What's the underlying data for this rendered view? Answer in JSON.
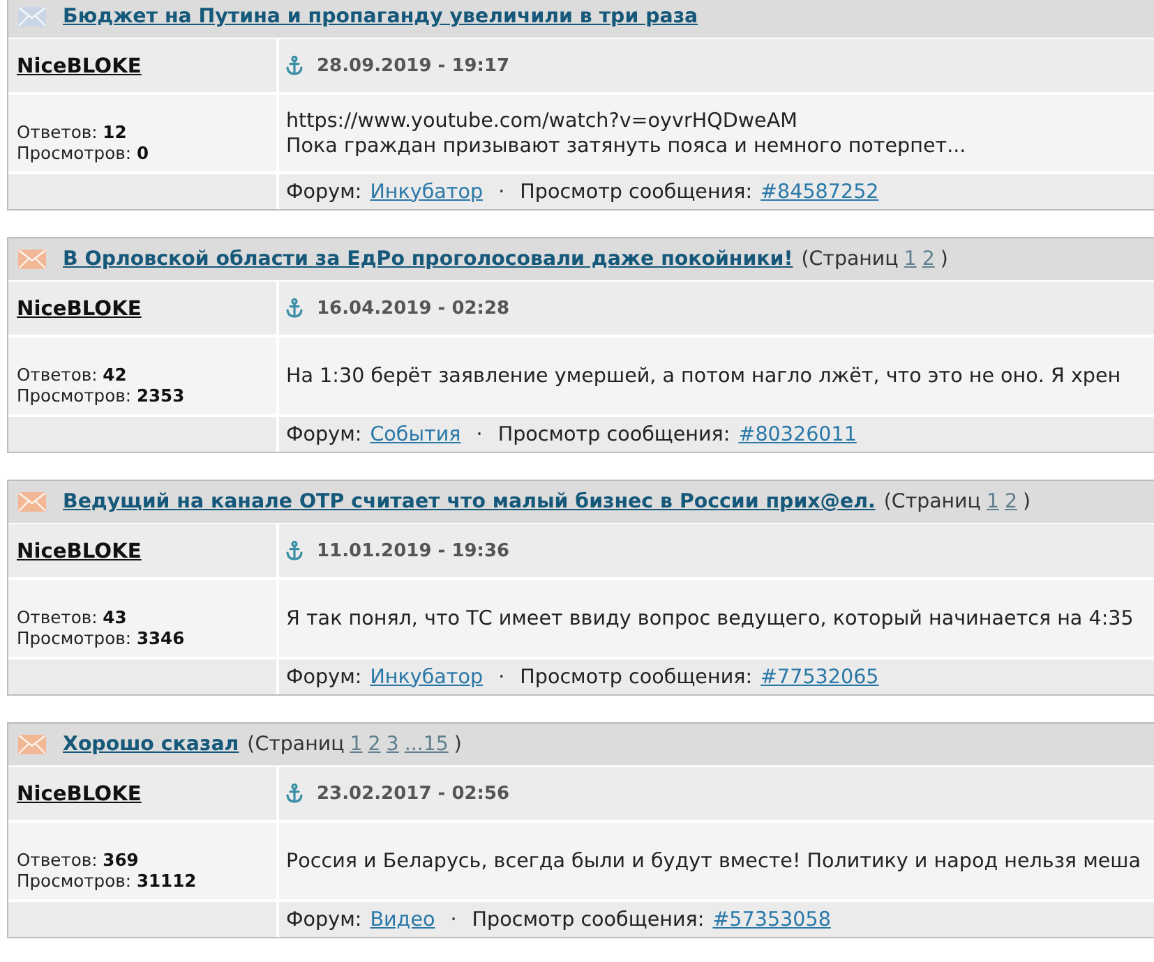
{
  "topics": [
    {
      "unread": false,
      "title": "Бюджет на Путина и пропаганду увеличили в три раза",
      "author": "NiceBLOKE",
      "date": "28.09.2019 - 19:17",
      "replies_label": "Ответов:",
      "replies": "12",
      "views_label": "Просмотров:",
      "views": "0",
      "message": [
        "https://www.youtube.com/watch?v=oyvrHQDweAM",
        "Пока граждан призывают затянуть пояса и немного потерпет..."
      ],
      "forum_label": "Форум:",
      "forum": "Инкубатор",
      "separator": "·",
      "post_label": "Просмотр сообщения:",
      "post": "#84587252"
    },
    {
      "unread": true,
      "title": "В Орловской области за ЕдРо проголосовали даже покойники!",
      "pages_label": "(Страниц",
      "pages": [
        "1",
        "2"
      ],
      "pages_close": ")",
      "author": "NiceBLOKE",
      "date": "16.04.2019 - 02:28",
      "replies_label": "Ответов:",
      "replies": "42",
      "views_label": "Просмотров:",
      "views": "2353",
      "message": [
        "На 1:30 берёт заявление умершей, а потом нагло лжёт, что это не оно. Я хрен"
      ],
      "forum_label": "Форум:",
      "forum": "События",
      "separator": "·",
      "post_label": "Просмотр сообщения:",
      "post": "#80326011"
    },
    {
      "unread": true,
      "title": "Ведущий на канале ОТР считает что малый бизнес в России прих@ел.",
      "pages_label": "(Страниц",
      "pages": [
        "1",
        "2"
      ],
      "pages_close": ")",
      "author": "NiceBLOKE",
      "date": "11.01.2019 - 19:36",
      "replies_label": "Ответов:",
      "replies": "43",
      "views_label": "Просмотров:",
      "views": "3346",
      "message": [
        "Я так понял, что ТС имеет ввиду вопрос ведущего, который начинается на 4:35"
      ],
      "forum_label": "Форум:",
      "forum": "Инкубатор",
      "separator": "·",
      "post_label": "Просмотр сообщения:",
      "post": "#77532065"
    },
    {
      "unread": true,
      "title": "Хорошо сказал",
      "pages_label": "(Страниц",
      "pages": [
        "1",
        "2",
        "3",
        "...15"
      ],
      "pages_close": ")",
      "author": "NiceBLOKE",
      "date": "23.02.2017 - 02:56",
      "replies_label": "Ответов:",
      "replies": "369",
      "views_label": "Просмотров:",
      "views": "31112",
      "message": [
        "Россия и Беларусь, всегда были и будут вместе! Политику и народ нельзя меша"
      ],
      "forum_label": "Форум:",
      "forum": "Видео",
      "separator": "·",
      "post_label": "Просмотр сообщения:",
      "post": "#57353058"
    }
  ]
}
